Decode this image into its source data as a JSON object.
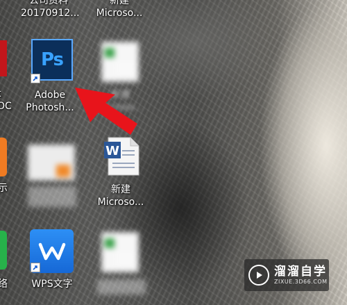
{
  "desktop": {
    "top_row": [
      {
        "label_line1": "公司资料",
        "label_line2": "20170912..."
      },
      {
        "label_line1": "新建",
        "label_line2": "Microso..."
      }
    ],
    "photoshop": {
      "tile_text": "Ps",
      "label_line1": "Adobe",
      "label_line2": "Photosh..."
    },
    "blurred_file_2": {
      "label_line1": "新建",
      "label_line2": "Microso..."
    },
    "word_doc": {
      "tile_letter": "W",
      "label_line1": "新建",
      "label_line2": "Microso..."
    },
    "wps": {
      "label": "WPS文字"
    },
    "left_edge": {
      "top": "t",
      "mid1": "OC",
      "mid2": "示",
      "bottom": "络"
    }
  },
  "watermark": {
    "title": "溜溜自学",
    "url": "ZIXUE.3D66.COM"
  },
  "colors": {
    "ps_blue": "#39a2ff",
    "arrow_red": "#e8141b",
    "wps_blue": "#1f7fe8"
  }
}
